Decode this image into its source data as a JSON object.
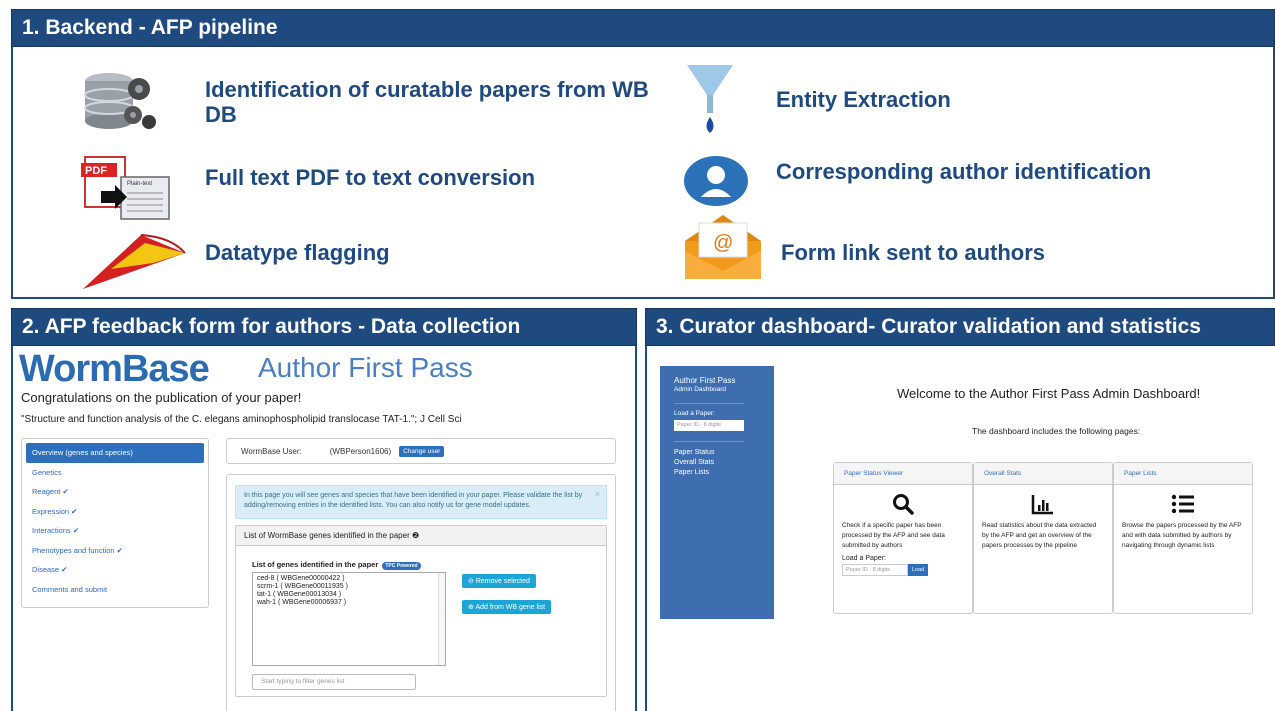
{
  "section1": {
    "title": "1.  Backend - AFP pipeline",
    "steps": [
      {
        "label": "Identification of curatable papers from WB DB",
        "icon": "database-gears-icon"
      },
      {
        "label": "Full text PDF to text conversion",
        "icon": "pdf-to-text-icon",
        "icon_text_pdf": "PDF",
        "icon_text_plain": "Plain-text"
      },
      {
        "label": "Datatype flagging",
        "icon": "flag-icon"
      },
      {
        "label": "Entity Extraction",
        "icon": "funnel-icon"
      },
      {
        "label": "Corresponding author identification",
        "icon": "person-icon"
      },
      {
        "label": "Form link sent  to authors",
        "icon": "email-envelope-icon",
        "icon_text": "@"
      }
    ]
  },
  "section2": {
    "title": "2. AFP feedback form for authors - Data collection",
    "logo": "WormBase",
    "subtitle": "Author First Pass",
    "congrats": "Congratulations on the publication of your paper!",
    "paper": "\"Structure and function analysis of the C. elegans aminophospholipid translocase TAT-1.\"; J Cell Sci",
    "menu": [
      "Overview (genes and species)",
      "Genetics",
      "Reagent ✔",
      "Expression ✔",
      "Interactions ✔",
      "Phenotypes and function ✔",
      "Disease ✔",
      "Comments and submit"
    ],
    "user_label": "WormBase User:",
    "user_id": "(WBPerson1606)",
    "change_user": "Change user",
    "info": "In this page you will see genes and species that have been identified in your paper. Please validate the list by adding/removing entries in the identified lists. You can also notify us for gene model updates.",
    "info_close": "×",
    "genes_panel_title": "List of WormBase genes identified in the paper ❷",
    "genes_list_title": "List of genes identified in the paper",
    "tpc_badge": "TPC Powered",
    "genes": [
      "ced-8 ( WBGene00000422 )",
      "scrm-1 ( WBGene00011935 )",
      "tat-1 ( WBGene00013034 )",
      "wah-1 ( WBGene00006937 )"
    ],
    "remove_btn": "Remove selected",
    "add_btn": "Add from WB gene list",
    "filter_placeholder": "Start typing to filter genes list"
  },
  "section3": {
    "title": "3. Curator dashboard- Curator validation and statistics",
    "sidebar": {
      "title": "Author First Pass",
      "subtitle": "Admin Dashboard",
      "load_label": "Load a Paper:",
      "input_placeholder": "Paper ID - 8 digits",
      "links": [
        "Paper Status",
        "Overall Stats",
        "Paper Lists"
      ]
    },
    "welcome": "Welcome to the Author First Pass Admin Dashboard!",
    "includes": "The dashboard includes the following pages:",
    "cards": [
      {
        "title": "Paper Status Viewer",
        "icon": "magnifier-icon",
        "desc": "Check if a specific paper has been processed by the AFP and see data submitted by authors",
        "load_label": "Load a Paper:",
        "input_placeholder": "Paper ID - 8 digits",
        "button": "Load"
      },
      {
        "title": "Overall Stats",
        "icon": "bar-chart-icon",
        "desc": "Read statistics about the data extracted by the AFP and get an overview of the papers processes by the pipeline"
      },
      {
        "title": "Paper Lists",
        "icon": "list-icon",
        "desc": "Browse the papers processed by the AFP and with data submitted by authors by navigating through dynamic lists"
      }
    ]
  }
}
